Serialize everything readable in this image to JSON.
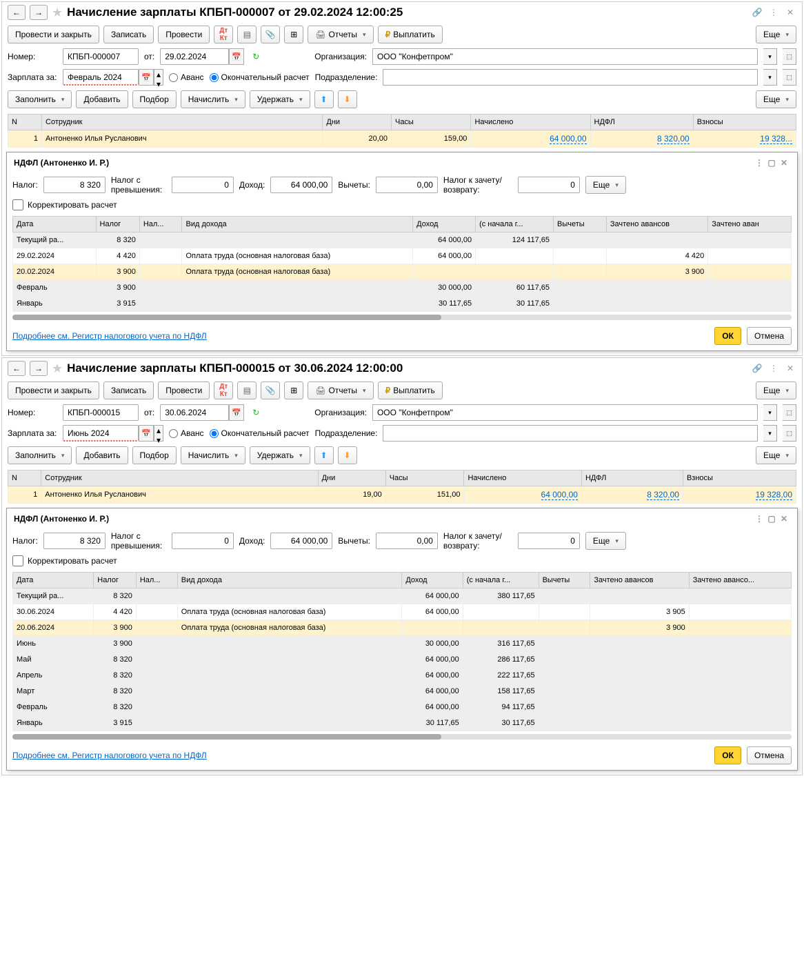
{
  "p1": {
    "title": "Начисление зарплаты КПБП-000007 от 29.02.2024 12:00:25",
    "toolbar": {
      "post_close": "Провести и закрыть",
      "save": "Записать",
      "post": "Провести",
      "reports": "Отчеты",
      "pay": "Выплатить",
      "more": "Еще"
    },
    "form": {
      "num_lbl": "Номер:",
      "num": "КПБП-000007",
      "from_lbl": "от:",
      "date": "29.02.2024",
      "org_lbl": "Организация:",
      "org": "ООО \"Конфетпром\"",
      "sal_lbl": "Зарплата за:",
      "period": "Февраль 2024",
      "advance": "Аванс",
      "final": "Окончательный расчет",
      "dept_lbl": "Подразделение:"
    },
    "tb2": {
      "fill": "Заполнить",
      "add": "Добавить",
      "pick": "Подбор",
      "calc": "Начислить",
      "hold": "Удержать",
      "more": "Еще"
    },
    "emp": {
      "cols": [
        "N",
        "Сотрудник",
        "Дни",
        "Часы",
        "Начислено",
        "НДФЛ",
        "Взносы"
      ],
      "rows": [
        {
          "n": "1",
          "name": "Антоненко Илья Русланович",
          "days": "20,00",
          "hours": "159,00",
          "sum": "64 000,00",
          "tax": "8 320,00",
          "fees": "19 328..."
        }
      ]
    },
    "ndfl": {
      "title": "НДФЛ (Антоненко И. Р.)",
      "tax_lbl": "Налог:",
      "tax": "8 320",
      "over_lbl": "Налог с превышения:",
      "over": "0",
      "income_lbl": "Доход:",
      "income": "64 000,00",
      "ded_lbl": "Вычеты:",
      "ded": "0,00",
      "ret_lbl": "Налог к зачету/возврату:",
      "ret": "0",
      "more": "Еще",
      "corr": "Корректировать расчет",
      "cols": [
        "Дата",
        "Налог",
        "Нал...",
        "Вид дохода",
        "Доход",
        "(с начала г...",
        "Вычеты",
        "Зачтено авансов",
        "Зачтено аван"
      ],
      "rows": [
        {
          "date": "Текущий ра...",
          "tax": "8 320",
          "inc": "64 000,00",
          "ytd": "124 117,65",
          "cls": "gray"
        },
        {
          "date": "29.02.2024",
          "tax": "4 420",
          "kind": "Оплата труда (основная налоговая база)",
          "inc": "64 000,00",
          "adv": "4 420"
        },
        {
          "date": "20.02.2024",
          "tax": "3 900",
          "kind": "Оплата труда (основная налоговая база)",
          "adv": "3 900",
          "cls": "hl"
        },
        {
          "date": "Февраль",
          "tax": "3 900",
          "inc": "30 000,00",
          "ytd": "60 117,65",
          "cls": "gray"
        },
        {
          "date": "Январь",
          "tax": "3 915",
          "inc": "30 117,65",
          "ytd": "30 117,65",
          "cls": "gray"
        }
      ],
      "link": "Подробнее см. Регистр налогового учета по НДФЛ",
      "ok": "ОК",
      "cancel": "Отмена"
    }
  },
  "p2": {
    "title": "Начисление зарплаты КПБП-000015 от 30.06.2024 12:00:00",
    "form": {
      "num": "КПБП-000015",
      "date": "30.06.2024",
      "period": "Июнь 2024"
    },
    "emp": {
      "rows": [
        {
          "n": "1",
          "name": "Антоненко Илья Русланович",
          "days": "19,00",
          "hours": "151,00",
          "sum": "64 000,00",
          "tax": "8 320,00",
          "fees": "19 328,00"
        }
      ]
    },
    "ndfl": {
      "title": "НДФЛ (Антоненко И. Р.)",
      "tax": "8 320",
      "over": "0",
      "income": "64 000,00",
      "ded": "0,00",
      "ret": "0",
      "cols": [
        "Дата",
        "Налог",
        "Нал...",
        "Вид дохода",
        "Доход",
        "(с начала г...",
        "Вычеты",
        "Зачтено авансов",
        "Зачтено авансо..."
      ],
      "rows": [
        {
          "date": "Текущий ра...",
          "tax": "8 320",
          "inc": "64 000,00",
          "ytd": "380 117,65",
          "cls": "gray"
        },
        {
          "date": "30.06.2024",
          "tax": "4 420",
          "kind": "Оплата труда (основная налоговая база)",
          "inc": "64 000,00",
          "adv": "3 905"
        },
        {
          "date": "20.06.2024",
          "tax": "3 900",
          "kind": "Оплата труда (основная налоговая база)",
          "adv": "3 900",
          "cls": "hl"
        },
        {
          "date": "Июнь",
          "tax": "3 900",
          "inc": "30 000,00",
          "ytd": "316 117,65",
          "cls": "gray"
        },
        {
          "date": "Май",
          "tax": "8 320",
          "inc": "64 000,00",
          "ytd": "286 117,65",
          "cls": "gray"
        },
        {
          "date": "Апрель",
          "tax": "8 320",
          "inc": "64 000,00",
          "ytd": "222 117,65",
          "cls": "gray"
        },
        {
          "date": "Март",
          "tax": "8 320",
          "inc": "64 000,00",
          "ytd": "158 117,65",
          "cls": "gray"
        },
        {
          "date": "Февраль",
          "tax": "8 320",
          "inc": "64 000,00",
          "ytd": "94 117,65",
          "cls": "gray"
        },
        {
          "date": "Январь",
          "tax": "3 915",
          "inc": "30 117,65",
          "ytd": "30 117,65",
          "cls": "gray"
        }
      ]
    }
  }
}
